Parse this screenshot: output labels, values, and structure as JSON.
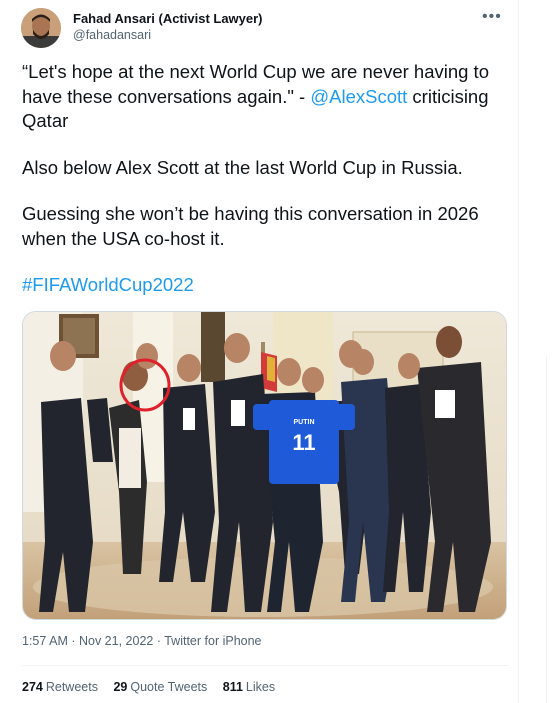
{
  "author": {
    "display_name": "Fahad Ansari (Activist Lawyer)",
    "handle": "@fahadansari",
    "more_icon": "more-horizontal-icon"
  },
  "tweet": {
    "line1_pre": "“Let's hope at the next World Cup we are never having to have these conversations again.\" - ",
    "mention": "@AlexScott",
    "line1_post": " criticising Qatar",
    "line2": "Also below Alex Scott at the last World Cup in Russia.",
    "line3": "Guessing she won’t be having this conversation in 2026 when the USA co-host it.",
    "hashtag": "#FIFAWorldCup2022"
  },
  "photo": {
    "jersey_name": "PUTIN",
    "jersey_number": "11",
    "highlight_color": "#e0202a"
  },
  "meta": {
    "time": "1:57 AM",
    "separator": " · ",
    "date": "Nov 21, 2022",
    "source": "Twitter for iPhone"
  },
  "stats": {
    "retweets_count": "274",
    "retweets_label": "Retweets",
    "quotes_count": "29",
    "quotes_label": "Quote Tweets",
    "likes_count": "811",
    "likes_label": "Likes"
  },
  "colors": {
    "link": "#1d9bf0",
    "muted": "#536471",
    "text": "#0f1419"
  }
}
